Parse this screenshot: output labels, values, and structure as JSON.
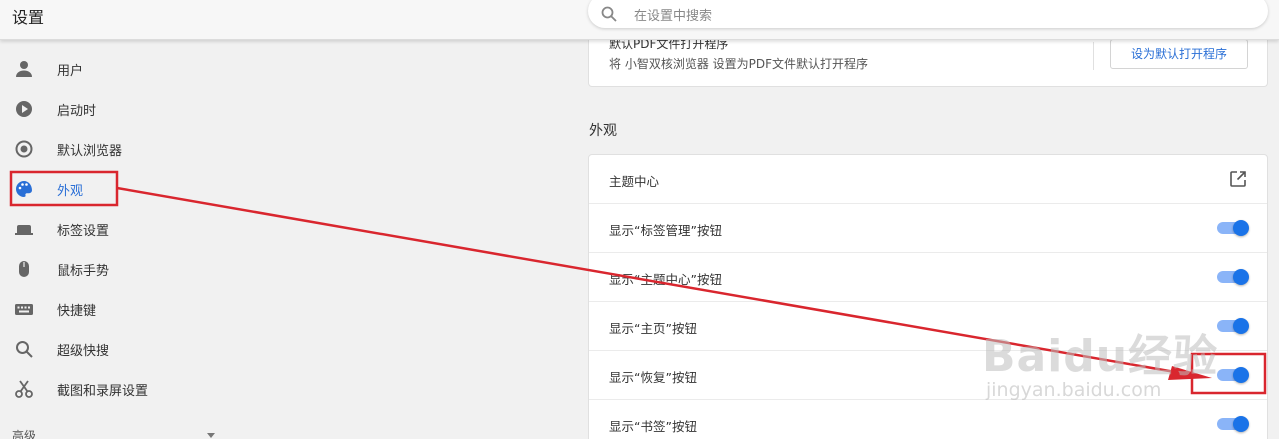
{
  "header": {
    "title": "设置"
  },
  "search": {
    "placeholder": "在设置中搜索",
    "icon": "search-icon"
  },
  "sidebar": {
    "items": [
      {
        "label": "用户",
        "icon": "user-icon"
      },
      {
        "label": "启动时",
        "icon": "play-icon"
      },
      {
        "label": "默认浏览器",
        "icon": "browser-icon"
      },
      {
        "label": "外观",
        "icon": "palette-icon",
        "active": true
      },
      {
        "label": "标签设置",
        "icon": "tab-icon"
      },
      {
        "label": "鼠标手势",
        "icon": "mouse-icon"
      },
      {
        "label": "快捷键",
        "icon": "keyboard-icon"
      },
      {
        "label": "超级快搜",
        "icon": "search-icon"
      },
      {
        "label": "截图和录屏设置",
        "icon": "scissors-icon"
      }
    ],
    "advanced_label": "高级"
  },
  "pdf": {
    "title": "默认PDF文件打开程序",
    "description": "将 小智双核浏览器 设置为PDF文件默认打开程序",
    "button_label": "设为默认打开程序"
  },
  "appearance": {
    "heading": "外观",
    "rows": [
      {
        "label": "主题中心",
        "control": "external-link"
      },
      {
        "label": "显示“标签管理”按钮",
        "control": "toggle",
        "on": true
      },
      {
        "label": "显示“主题中心”按钮",
        "control": "toggle",
        "on": true
      },
      {
        "label": "显示“主页”按钮",
        "control": "toggle",
        "on": true
      },
      {
        "label": "显示“恢复”按钮",
        "control": "toggle",
        "on": true
      },
      {
        "label": "显示“书签”按钮",
        "control": "toggle",
        "on": true
      }
    ]
  },
  "watermark": {
    "main": "Baidu经验",
    "sub": "jingyan.baidu.com"
  },
  "colors": {
    "accent": "#1a73e8",
    "annotation": "#d9262e",
    "active_text": "#2a6fd6"
  }
}
